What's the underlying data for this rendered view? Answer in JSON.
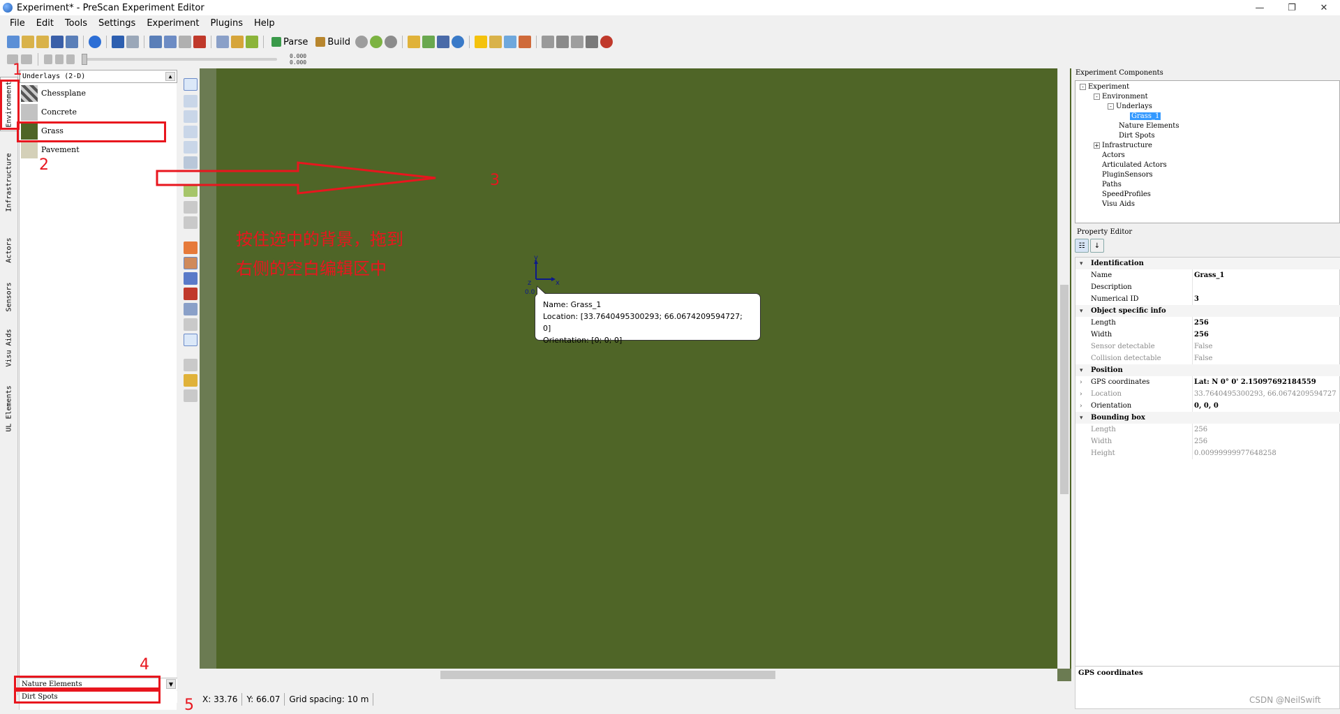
{
  "window": {
    "title": "Experiment* - PreScan Experiment Editor",
    "controls": [
      "—",
      "❐",
      "✕"
    ]
  },
  "menu": [
    "File",
    "Edit",
    "Tools",
    "Settings",
    "Experiment",
    "Plugins",
    "Help"
  ],
  "toolbar": {
    "parse_label": "Parse",
    "build_label": "Build"
  },
  "playbar": {
    "time_top": "0.000",
    "time_bottom": "0.000"
  },
  "left_tabs": [
    "Environment",
    "Infrastructure",
    "Actors",
    "Sensors",
    "Visu Aids",
    "UL Elements"
  ],
  "library": {
    "header": "Underlays (2-D)",
    "items": [
      "Chessplane",
      "Concrete",
      "Grass",
      "Pavement"
    ],
    "footer_section": "Nature Elements",
    "footer_section2": "Dirt Spots"
  },
  "annotations": {
    "n1": "1",
    "n2": "2",
    "n3": "3",
    "n4": "4",
    "n5": "5",
    "instruction_line1": "按住选中的背景，拖到",
    "instruction_line2": "右侧的空白编辑区中"
  },
  "canvas": {
    "tooltip_name": "Name: Grass_1",
    "tooltip_location": "Location: [33.7640495300293; 66.0674209594727; 0]",
    "tooltip_orientation": "Orientation: [0; 0; 0]",
    "axis_y": "y",
    "axis_x": "x",
    "axis_z": "z",
    "origin_label": "0.0"
  },
  "status": {
    "x": "X: 33.76",
    "y": "Y: 66.07",
    "grid": "Grid spacing: 10 m"
  },
  "components": {
    "title": "Experiment Components",
    "tree": [
      {
        "label": "Experiment",
        "exp": "-"
      },
      {
        "label": "Environment",
        "exp": "-"
      },
      {
        "label": "Underlays",
        "exp": "-"
      },
      {
        "label": "Grass_1",
        "exp": ""
      },
      {
        "label": "Nature Elements",
        "exp": ""
      },
      {
        "label": "Dirt Spots",
        "exp": ""
      },
      {
        "label": "Infrastructure",
        "exp": "+"
      },
      {
        "label": "Actors",
        "exp": ""
      },
      {
        "label": "Articulated Actors",
        "exp": ""
      },
      {
        "label": "PluginSensors",
        "exp": ""
      },
      {
        "label": "Paths",
        "exp": ""
      },
      {
        "label": "SpeedProfiles",
        "exp": ""
      },
      {
        "label": "Visu Aids",
        "exp": ""
      }
    ]
  },
  "property_editor": {
    "title": "Property Editor",
    "rows": [
      {
        "type": "cat",
        "name": "Identification"
      },
      {
        "type": "prop",
        "name": "Name",
        "value": "Grass_1",
        "bold": true
      },
      {
        "type": "prop",
        "name": "Description",
        "value": ""
      },
      {
        "type": "prop",
        "name": "Numerical ID",
        "value": "3",
        "bold": true
      },
      {
        "type": "cat",
        "name": "Object specific info"
      },
      {
        "type": "prop",
        "name": "Length",
        "value": "256",
        "bold": true
      },
      {
        "type": "prop",
        "name": "Width",
        "value": "256",
        "bold": true
      },
      {
        "type": "prop",
        "name": "Sensor detectable",
        "value": "False",
        "dim": true
      },
      {
        "type": "prop",
        "name": "Collision detectable",
        "value": "False",
        "dim": true
      },
      {
        "type": "cat",
        "name": "Position"
      },
      {
        "type": "prop",
        "name": "GPS coordinates",
        "value": "Lat: N 0°  0' 2.15097692184559",
        "bold": true,
        "chev": true
      },
      {
        "type": "prop",
        "name": "Location",
        "value": "33.7640495300293, 66.0674209594727",
        "dim": true,
        "chev": true
      },
      {
        "type": "prop",
        "name": "Orientation",
        "value": "0, 0, 0",
        "bold": true,
        "chev": true
      },
      {
        "type": "cat",
        "name": "Bounding box"
      },
      {
        "type": "prop",
        "name": "Length",
        "value": "256",
        "dim": true
      },
      {
        "type": "prop",
        "name": "Width",
        "value": "256",
        "dim": true
      },
      {
        "type": "prop",
        "name": "Height",
        "value": "0.00999999977648258",
        "dim": true
      }
    ],
    "description_title": "GPS coordinates"
  },
  "watermark": "CSDN @NeilSwift",
  "colors": {
    "grass": "#4f6527",
    "annotation_red": "#e8161e",
    "selection": "#3399ff"
  }
}
